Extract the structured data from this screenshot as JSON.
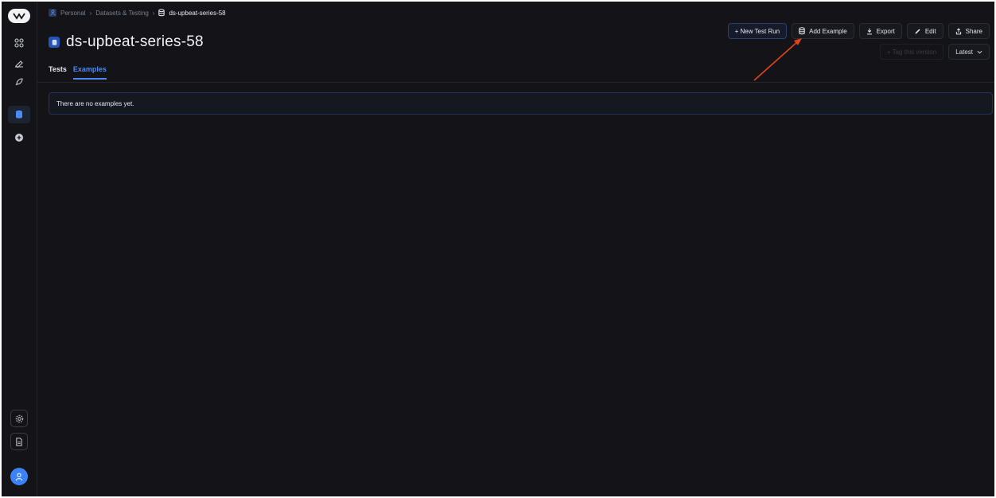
{
  "breadcrumb": {
    "items": [
      "Personal",
      "Datasets & Testing",
      "ds-upbeat-series-58"
    ],
    "separator": "›"
  },
  "page": {
    "title": "ds-upbeat-series-58"
  },
  "toolbar": {
    "new_test_run": "+ New Test Run",
    "add_example": "Add Example",
    "export": "Export",
    "edit": "Edit",
    "share": "Share",
    "tag_version": "+ Tag this version",
    "version_select": "Latest"
  },
  "tabs": [
    {
      "label": "Tests",
      "active": false
    },
    {
      "label": "Examples",
      "active": true
    }
  ],
  "examples": {
    "empty_message": "There are no examples yet."
  },
  "sidebar": {
    "icons": [
      "grid-icon",
      "pen-icon",
      "rocket-icon",
      "database-icon",
      "plus-circle-icon",
      "settings-icon",
      "document-icon",
      "user-avatar"
    ]
  },
  "colors": {
    "background": "#141418",
    "accent": "#4a8af4",
    "annotation_arrow": "#e2421c"
  }
}
